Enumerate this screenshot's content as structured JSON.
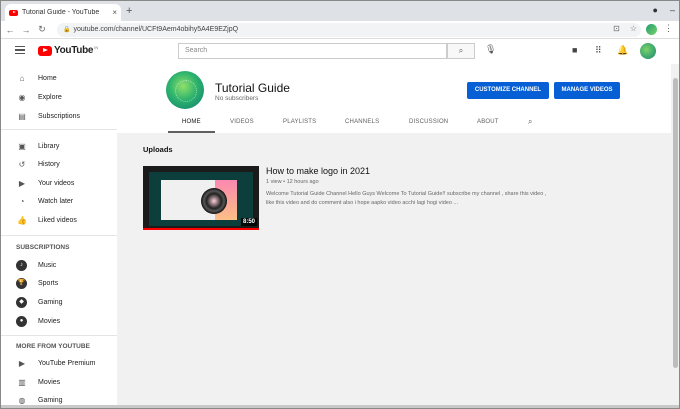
{
  "browser": {
    "tab_title": "Tutorial Guide - YouTube",
    "tab_close": "×",
    "new_tab": "+",
    "url": "youtube.com/channel/UCFt9Aem4obihy5A4E9EZjpQ",
    "back": "←",
    "forward": "→",
    "reload": "↻",
    "menu": "⋮"
  },
  "header": {
    "logo_text": "YouTube",
    "logo_region": "IN",
    "search_placeholder": "Search",
    "search_icon": "search-icon",
    "mic_icon": "mic-icon"
  },
  "sidebar": {
    "main": [
      {
        "label": "Home",
        "icon": "home-icon"
      },
      {
        "label": "Explore",
        "icon": "compass-icon"
      },
      {
        "label": "Subscriptions",
        "icon": "subscriptions-icon"
      }
    ],
    "library": [
      {
        "label": "Library",
        "icon": "library-icon"
      },
      {
        "label": "History",
        "icon": "history-icon"
      },
      {
        "label": "Your videos",
        "icon": "your-videos-icon"
      },
      {
        "label": "Watch later",
        "icon": "clock-icon"
      },
      {
        "label": "Liked videos",
        "icon": "thumbs-up-icon"
      }
    ],
    "subscriptions_heading": "SUBSCRIPTIONS",
    "subscriptions": [
      {
        "label": "Music"
      },
      {
        "label": "Sports"
      },
      {
        "label": "Gaming"
      },
      {
        "label": "Movies"
      }
    ],
    "more_heading": "MORE FROM YOUTUBE",
    "more": [
      {
        "label": "YouTube Premium",
        "icon": "youtube-icon"
      },
      {
        "label": "Movies",
        "icon": "film-icon"
      },
      {
        "label": "Gaming",
        "icon": "gamepad-icon"
      }
    ]
  },
  "channel": {
    "name": "Tutorial Guide",
    "subscribers": "No subscribers",
    "customize_button": "CUSTOMIZE CHANNEL",
    "manage_button": "MANAGE VIDEOS",
    "tabs": [
      "HOME",
      "VIDEOS",
      "PLAYLISTS",
      "CHANNELS",
      "DISCUSSION",
      "ABOUT"
    ],
    "active_tab": "HOME"
  },
  "uploads": {
    "heading": "Uploads",
    "videos": [
      {
        "title": "How to make logo in 2021",
        "meta": "1 view • 12 hours ago",
        "description": "Welcome Tutorial Guide Channel Hello Guys Welcome To Tutorial Guide!! subscribe my channel , share this video , like this video and do comment also i hope aapko video acchi lagi hogi video ...",
        "duration": "8:50"
      }
    ]
  },
  "colors": {
    "youtube_red": "#ff0000",
    "button_blue": "#065fd4"
  }
}
